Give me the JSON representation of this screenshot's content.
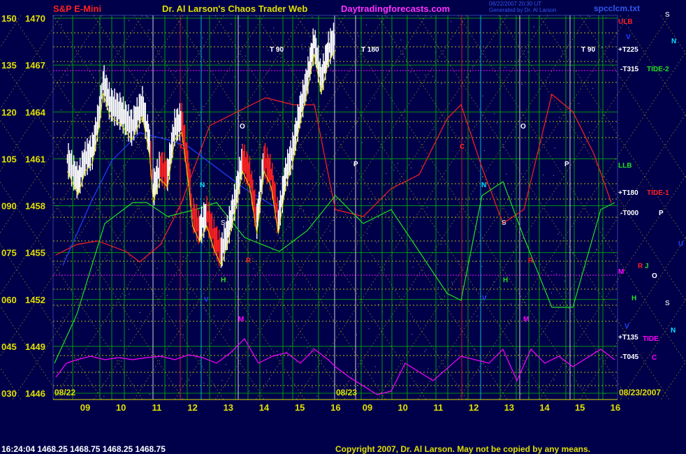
{
  "header": {
    "instrument": "S&P E-Mini",
    "title": "Dr. Al Larson's Chaos Trader Web",
    "site": "Daytradingforecasts.com",
    "timestamp_line1": "08/22/2007 20:30 UT",
    "timestamp_line2": "Generated by Dr. Al Larson",
    "file": "spcclcm.txt"
  },
  "footer": {
    "quote": "16:24:04  1468.25  1468.75  1468.25  1468.75",
    "copyright": "Copyright 2007, Dr. Al Larson. May not be copied by any means."
  },
  "colors": {
    "background": "#00004a",
    "price_bars": "#ffffff",
    "down_bars": "#ff2020",
    "grid_green": "#00c000",
    "grid_yellow": "#e0e000",
    "tide_magenta": "#ff00ff",
    "red_field": "#ff2020",
    "green_field": "#20e020",
    "blue_field": "#2040ff"
  },
  "chart_data": {
    "type": "line",
    "title": "S&P E-Mini",
    "ylim": [
      1446,
      1470.5
    ],
    "y_ticks": [
      {
        "left": "150",
        "right": "1470"
      },
      {
        "left": "135",
        "right": "1467"
      },
      {
        "left": "120",
        "right": "1464"
      },
      {
        "left": "105",
        "right": "1461"
      },
      {
        "left": "090",
        "right": "1458"
      },
      {
        "left": "075",
        "right": "1455"
      },
      {
        "left": "060",
        "right": "1452"
      },
      {
        "left": "045",
        "right": "1449"
      },
      {
        "left": "030",
        "right": "1446"
      }
    ],
    "x_ticks": [
      "09",
      "10",
      "11",
      "12",
      "13",
      "14",
      "15",
      "16",
      "09",
      "10",
      "11",
      "12",
      "13",
      "14",
      "15",
      "16"
    ],
    "date_labels": [
      "08/22",
      "08/23",
      "08/23/2007"
    ],
    "price_series": {
      "name": "price",
      "hours": [
        8.5,
        8.8,
        9.0,
        9.2,
        9.4,
        9.5,
        9.7,
        10.0,
        10.3,
        10.6,
        10.8,
        10.9,
        11.1,
        11.3,
        11.5,
        11.7,
        11.9,
        12.0,
        12.2,
        12.4,
        12.6,
        12.8,
        13.0,
        13.2,
        13.4,
        13.6,
        13.8,
        14.0,
        14.2,
        14.4,
        14.6,
        14.8,
        15.0,
        15.2,
        15.4,
        15.6,
        15.8,
        16.0
      ],
      "values": [
        1461,
        1459.5,
        1461,
        1461.5,
        1464,
        1466,
        1464.5,
        1464,
        1463,
        1464.5,
        1462,
        1459,
        1460.5,
        1460,
        1463,
        1463.5,
        1460,
        1457.5,
        1456.5,
        1457.5,
        1456,
        1455,
        1456.5,
        1458.5,
        1461,
        1460,
        1457,
        1461,
        1460,
        1457,
        1460,
        1461.5,
        1464,
        1466,
        1468.5,
        1466,
        1468,
        1468.75
      ]
    },
    "annotations": [
      {
        "text": "T 90"
      },
      {
        "text": "T 180"
      },
      {
        "text": "T 90"
      },
      {
        "text": "O"
      },
      {
        "text": "O"
      },
      {
        "text": "P"
      },
      {
        "text": "P"
      },
      {
        "text": "C"
      },
      {
        "text": "C"
      },
      {
        "text": "N"
      },
      {
        "text": "N"
      },
      {
        "text": "S"
      },
      {
        "text": "S"
      },
      {
        "text": "H"
      },
      {
        "text": "H"
      },
      {
        "text": "R"
      },
      {
        "text": "R"
      },
      {
        "text": "M"
      },
      {
        "text": "M"
      },
      {
        "text": "V"
      },
      {
        "text": "V"
      }
    ],
    "right_labels": [
      {
        "text": "ULB",
        "color": "#ff2020"
      },
      {
        "text": "+T225",
        "color": "#ffffff"
      },
      {
        "text": "-T315",
        "color": "#ffffff"
      },
      {
        "text": "TIDE-2",
        "color": "#20e020"
      },
      {
        "text": "LLB",
        "color": "#20e020"
      },
      {
        "text": "+T180",
        "color": "#ffffff"
      },
      {
        "text": "TIDE-1",
        "color": "#ff2020"
      },
      {
        "text": "-T000",
        "color": "#ffffff"
      },
      {
        "text": "M",
        "color": "#ff00ff"
      },
      {
        "text": "+T135",
        "color": "#ffffff"
      },
      {
        "text": "TIDE",
        "color": "#ff00ff"
      },
      {
        "text": "-T045",
        "color": "#ffffff"
      }
    ],
    "planet_labels": [
      {
        "text": "S",
        "color": "#c8c8c8"
      },
      {
        "text": "N",
        "color": "#00e0ff"
      },
      {
        "text": "V",
        "color": "#2040ff"
      },
      {
        "text": "P",
        "color": "#ffffff"
      },
      {
        "text": "U",
        "color": "#2040ff"
      },
      {
        "text": "R",
        "color": "#ff2020"
      },
      {
        "text": "J",
        "color": "#20e020"
      },
      {
        "text": "O",
        "color": "#ffffff"
      },
      {
        "text": "H",
        "color": "#20e020"
      },
      {
        "text": "S",
        "color": "#c8c8c8"
      },
      {
        "text": "V",
        "color": "#2040ff"
      },
      {
        "text": "N",
        "color": "#00e0ff"
      },
      {
        "text": "C",
        "color": "#ff00ff"
      }
    ]
  }
}
